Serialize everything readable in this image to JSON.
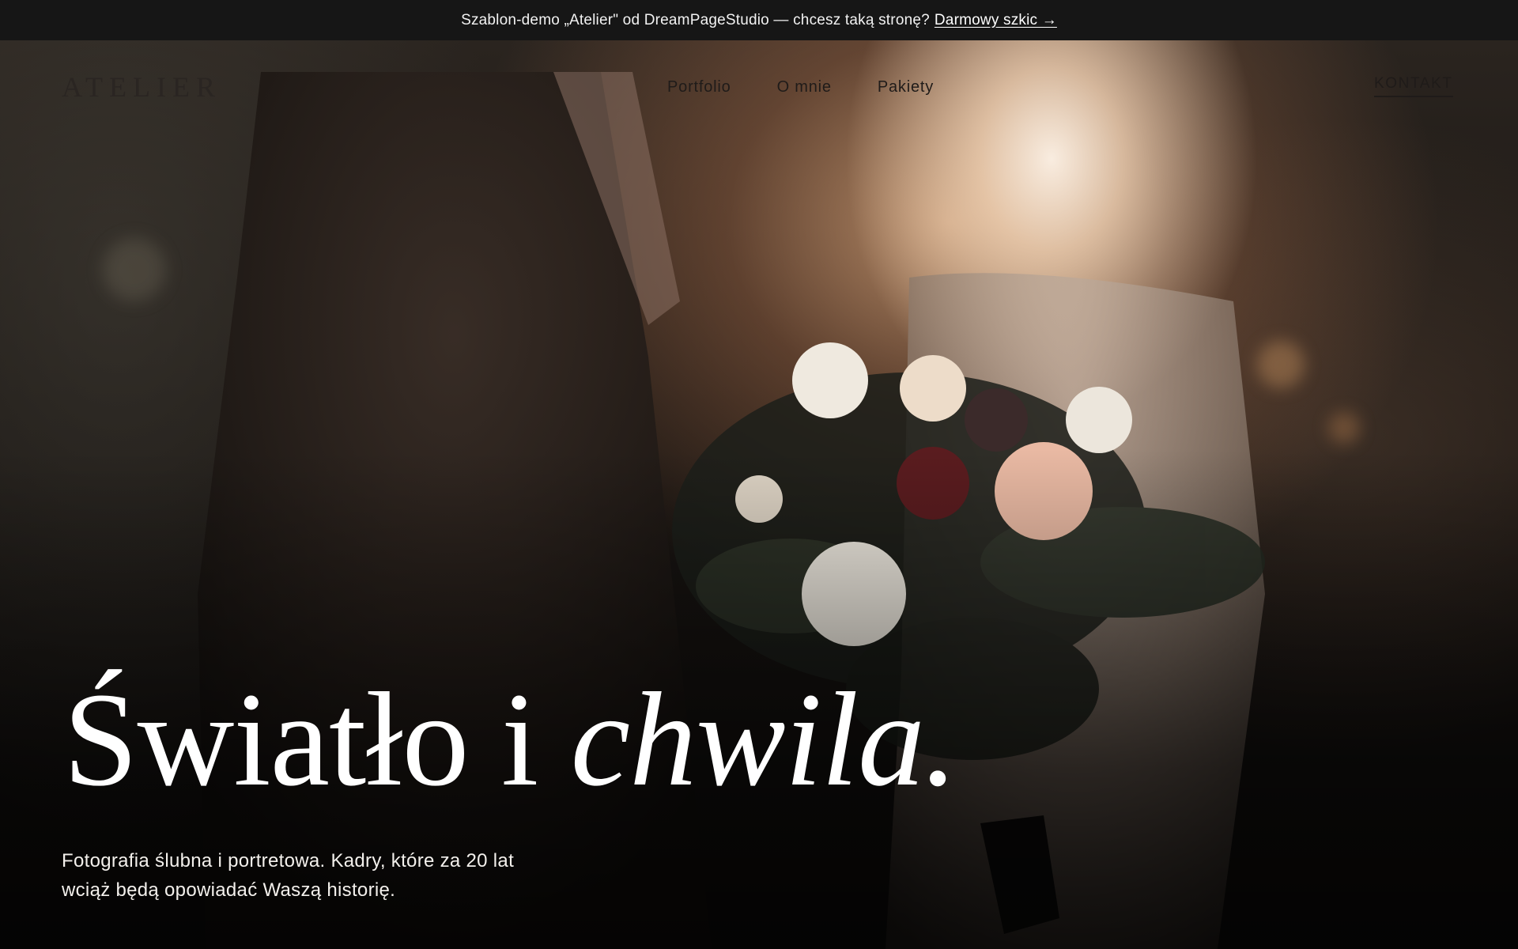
{
  "promo": {
    "text": "Szablon-demo „Atelier\" od DreamPageStudio — chcesz taką stronę?",
    "link_label": "Darmowy szkic →"
  },
  "header": {
    "logo": "ATELIER",
    "nav": [
      {
        "label": "Portfolio"
      },
      {
        "label": "O mnie"
      },
      {
        "label": "Pakiety"
      }
    ],
    "contact_label": "KONTAKT"
  },
  "hero": {
    "title_plain": "Światło i ",
    "title_italic": "chwila.",
    "description": "Fotografia ślubna i portretowa. Kadry, które za 20 lat wciąż będą opowiadać Waszą historię."
  }
}
